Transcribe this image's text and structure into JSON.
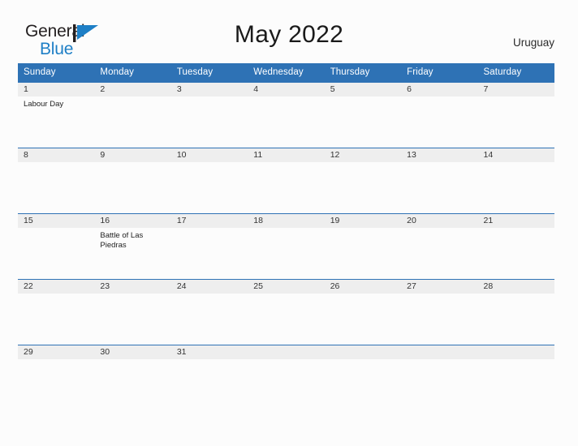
{
  "brand": {
    "name_part1": "General",
    "name_part2": "Blue",
    "flag_icon": "flag-triangle-icon",
    "accent_color": "#1e7fc6"
  },
  "header": {
    "title": "May 2022",
    "region": "Uruguay"
  },
  "colors": {
    "header_blue": "#2e72b5",
    "date_band_gray": "#eeeeee",
    "page_background": "#fcfcfc",
    "text_dark": "#1f1f1f"
  },
  "calendar": {
    "month": "May",
    "year": "2022",
    "weekday_headers": [
      "Sunday",
      "Monday",
      "Tuesday",
      "Wednesday",
      "Thursday",
      "Friday",
      "Saturday"
    ],
    "weeks": [
      [
        {
          "day": "1",
          "events": [
            "Labour Day"
          ]
        },
        {
          "day": "2",
          "events": []
        },
        {
          "day": "3",
          "events": []
        },
        {
          "day": "4",
          "events": []
        },
        {
          "day": "5",
          "events": []
        },
        {
          "day": "6",
          "events": []
        },
        {
          "day": "7",
          "events": []
        }
      ],
      [
        {
          "day": "8",
          "events": []
        },
        {
          "day": "9",
          "events": []
        },
        {
          "day": "10",
          "events": []
        },
        {
          "day": "11",
          "events": []
        },
        {
          "day": "12",
          "events": []
        },
        {
          "day": "13",
          "events": []
        },
        {
          "day": "14",
          "events": []
        }
      ],
      [
        {
          "day": "15",
          "events": []
        },
        {
          "day": "16",
          "events": [
            "Battle of Las Piedras"
          ]
        },
        {
          "day": "17",
          "events": []
        },
        {
          "day": "18",
          "events": []
        },
        {
          "day": "19",
          "events": []
        },
        {
          "day": "20",
          "events": []
        },
        {
          "day": "21",
          "events": []
        }
      ],
      [
        {
          "day": "22",
          "events": []
        },
        {
          "day": "23",
          "events": []
        },
        {
          "day": "24",
          "events": []
        },
        {
          "day": "25",
          "events": []
        },
        {
          "day": "26",
          "events": []
        },
        {
          "day": "27",
          "events": []
        },
        {
          "day": "28",
          "events": []
        }
      ],
      [
        {
          "day": "29",
          "events": []
        },
        {
          "day": "30",
          "events": []
        },
        {
          "day": "31",
          "events": []
        },
        {
          "day": "",
          "events": []
        },
        {
          "day": "",
          "events": []
        },
        {
          "day": "",
          "events": []
        },
        {
          "day": "",
          "events": []
        }
      ]
    ]
  }
}
